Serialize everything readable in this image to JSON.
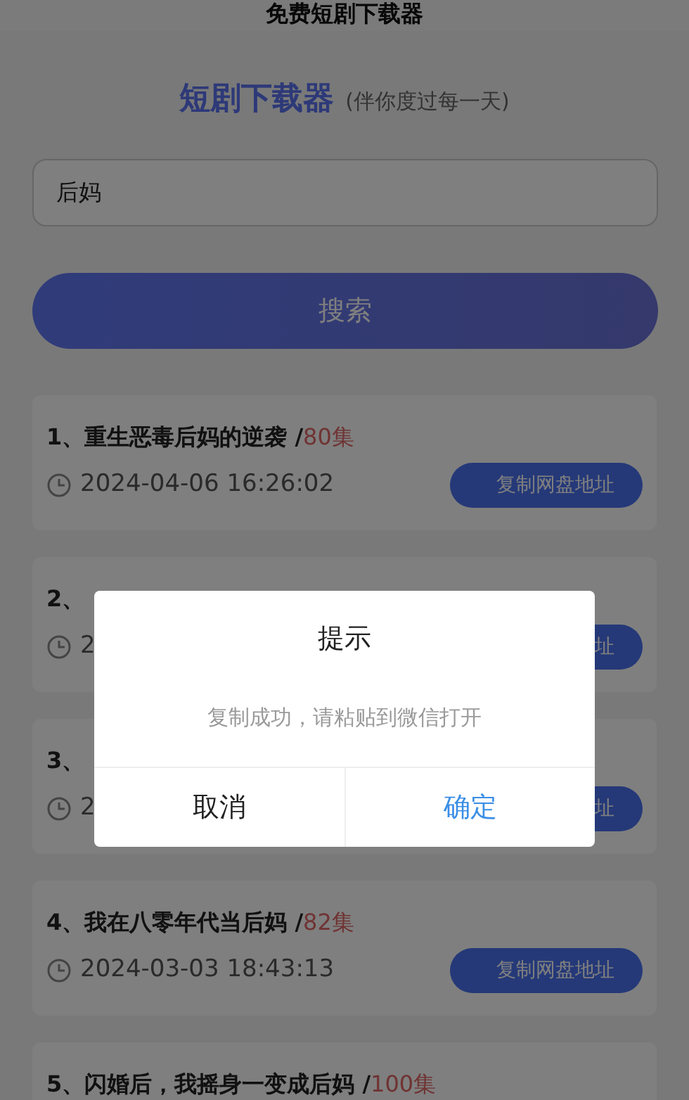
{
  "header": {
    "title": "免费短剧下载器"
  },
  "brand": {
    "name": "短剧下载器",
    "slogan": "(伴你度过每一天)"
  },
  "search": {
    "value": "后妈",
    "button": "搜索"
  },
  "results": [
    {
      "title": "1、重生恶毒后妈的逆袭 /",
      "count": "80集",
      "date": "2024-04-06 16:26:02",
      "button": "复制网盘地址"
    },
    {
      "title": "2、",
      "date": "2",
      "button": "址"
    },
    {
      "title": "3、",
      "date": "2",
      "button": "址"
    },
    {
      "title": "4、我在八零年代当后妈 /",
      "count": "82集",
      "date": "2024-03-03 18:43:13",
      "button": "复制网盘地址"
    },
    {
      "title": "5、闪婚后，我摇身一变成后妈 /",
      "count": "100集"
    }
  ],
  "dialog": {
    "title": "提示",
    "message": "复制成功，请粘贴到微信打开",
    "buttons": [
      {
        "label": "取消",
        "kind": "cancel"
      },
      {
        "label": "确定",
        "kind": "confirm"
      }
    ]
  }
}
